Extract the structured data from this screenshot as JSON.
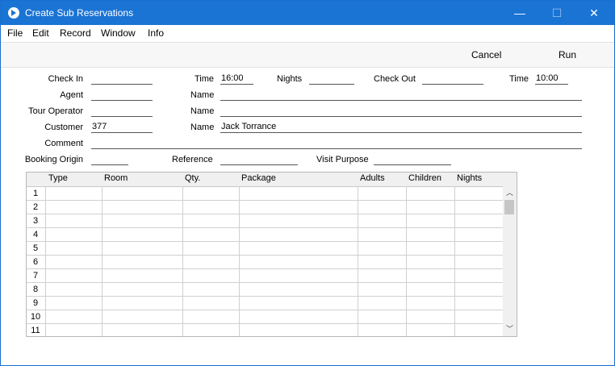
{
  "window": {
    "title": "Create Sub Reservations",
    "minimize": "—",
    "maximize": "☐",
    "close": "✕"
  },
  "menu": [
    "File",
    "Edit",
    "Record",
    "Window",
    "Info"
  ],
  "toolbar": {
    "cancel": "Cancel",
    "run": "Run"
  },
  "form": {
    "check_in_label": "Check In",
    "check_in_value": "",
    "time1_label": "Time",
    "time1_value": "16:00",
    "nights_label": "Nights",
    "nights_value": "",
    "check_out_label": "Check Out",
    "check_out_value": "",
    "time2_label": "Time",
    "time2_value": "10:00",
    "agent_label": "Agent",
    "agent_value": "",
    "agent_name_label": "Name",
    "agent_name_value": "",
    "tour_operator_label": "Tour Operator",
    "tour_operator_value": "",
    "tour_name_label": "Name",
    "tour_name_value": "",
    "customer_label": "Customer",
    "customer_value": "377",
    "customer_name_label": "Name",
    "customer_name_value": "Jack Torrance",
    "comment_label": "Comment",
    "comment_value": "",
    "booking_origin_label": "Booking Origin",
    "booking_origin_value": "",
    "reference_label": "Reference",
    "reference_value": "",
    "visit_purpose_label": "Visit Purpose",
    "visit_purpose_value": ""
  },
  "grid": {
    "columns": [
      "Type",
      "Room",
      "Qty.",
      "Package",
      "Adults",
      "Children",
      "Nights"
    ],
    "rows": [
      "1",
      "2",
      "3",
      "4",
      "5",
      "6",
      "7",
      "8",
      "9",
      "10",
      "11"
    ]
  }
}
